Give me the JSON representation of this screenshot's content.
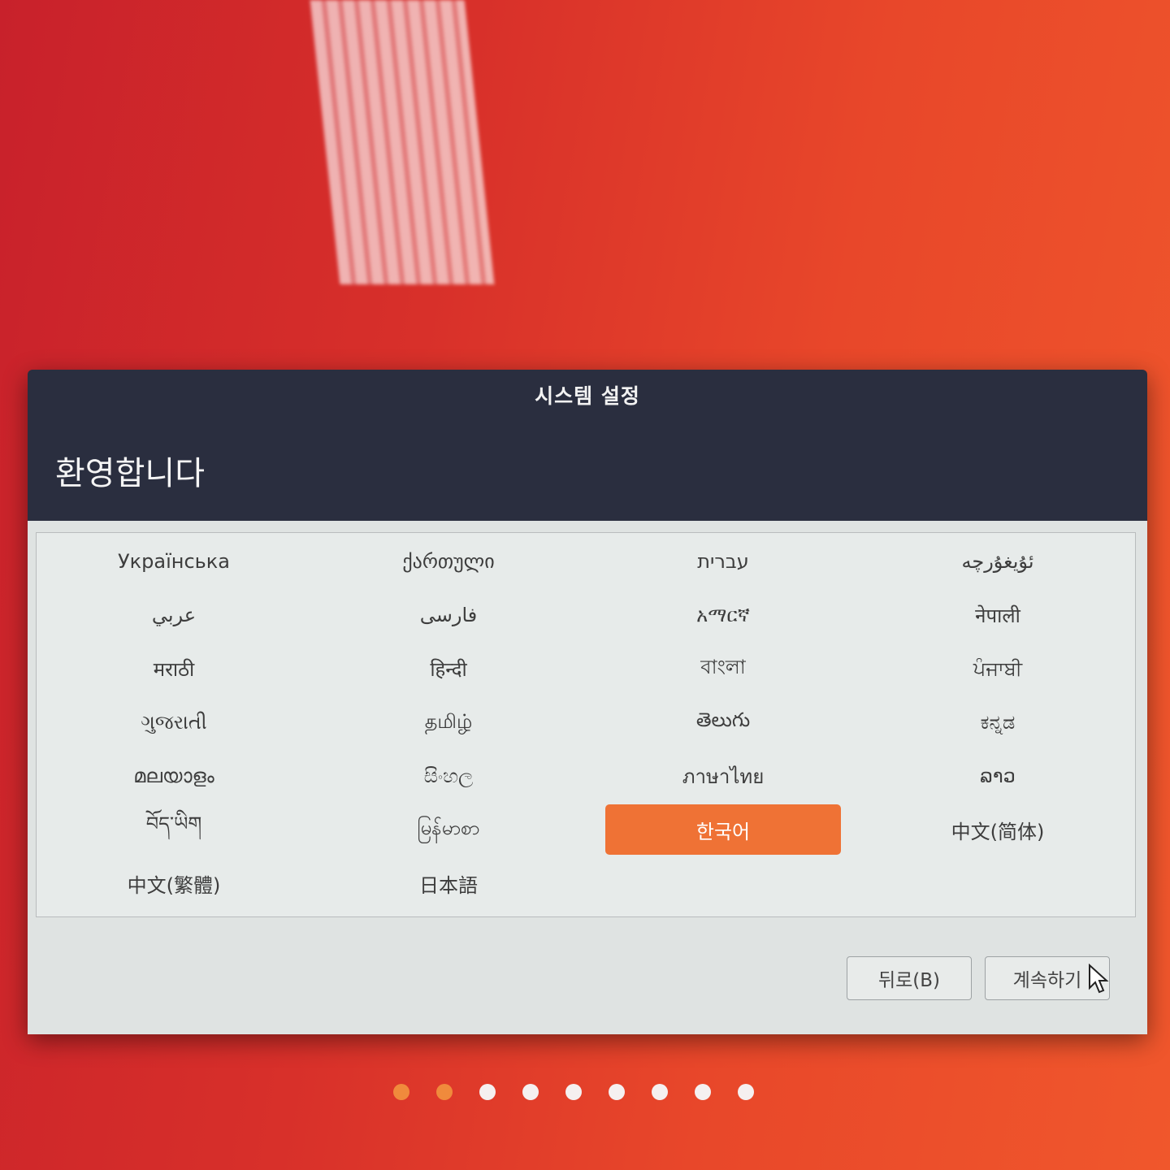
{
  "dialog": {
    "title": "시스템 설정",
    "heading": "환영합니다"
  },
  "languages": [
    "Українська",
    "ქართული",
    "עברית",
    "ئۇيغۇرچە",
    "عربي",
    "فارسی",
    "አማርኛ",
    "नेपाली",
    "मराठी",
    "हिन्दी",
    "বাংলা",
    "ਪੰਜਾਬੀ",
    "ગુજરાતી",
    "தமிழ்",
    "తెలుగు",
    "ಕನ್ನಡ",
    "മലയാളം",
    "සිංහල",
    "ภาษาไทย",
    "ລາວ",
    "བོད་ཡིག",
    "မြန်မာစာ",
    "한국어",
    "中文(简体)",
    "中文(繁體)",
    "日本語"
  ],
  "selected_language": "한국어",
  "buttons": {
    "back": "뒤로(B)",
    "continue": "계속하기"
  },
  "progress": {
    "total_steps": 9,
    "active_steps": 2
  },
  "colors": {
    "accent": "#ef7235",
    "dialog_header": "#2a2e3f",
    "content_bg": "#dfe3e2"
  }
}
